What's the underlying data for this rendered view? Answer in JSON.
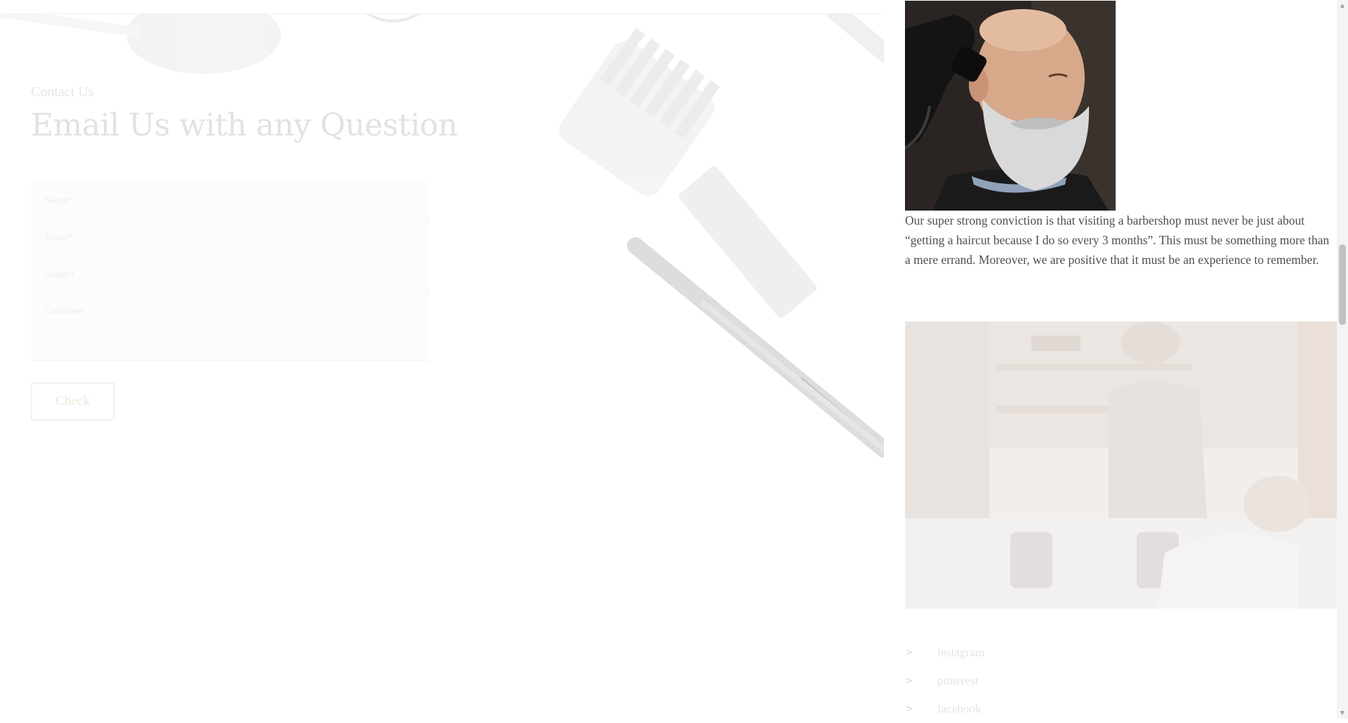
{
  "contact": {
    "eyebrow": "Contact Us",
    "headline": "Email Us with any Question",
    "fields": [
      {
        "placeholder": "Name*"
      },
      {
        "placeholder": "Email*"
      },
      {
        "placeholder": "Subject"
      },
      {
        "placeholder": "Comment"
      }
    ],
    "submit_label": "Check"
  },
  "about": {
    "text": "Our super strong conviction is that visiting a barbershop must never be just about “getting a haircut because I do so every 3 months”. This must be something more than a mere errand. Moreover, we are positive that it must be an experience to remember."
  },
  "social": {
    "links": [
      {
        "icon": "chevron-right-icon",
        "label": "instagram"
      },
      {
        "icon": "chevron-right-icon",
        "label": "pinterest"
      },
      {
        "icon": "chevron-right-icon",
        "label": "facebook"
      }
    ]
  },
  "colors": {
    "text": "#4f4f4f",
    "faded_text": "#e2e2e2",
    "scrollbar_track": "#f4f4f4",
    "scrollbar_thumb": "#c1c1c1"
  }
}
